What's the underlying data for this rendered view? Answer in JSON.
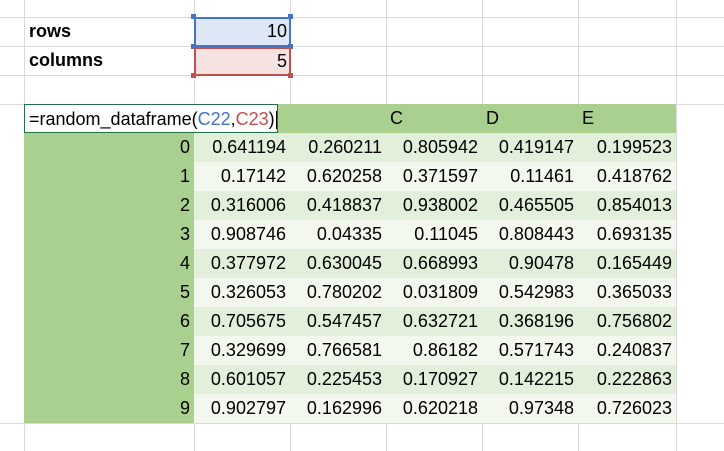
{
  "params": {
    "rows_label": "rows",
    "rows_value": "10",
    "columns_label": "columns",
    "columns_value": "5"
  },
  "formula": {
    "prefix": "=random_dataframe(",
    "ref1": "C22",
    "sep": ",",
    "ref2": "C23",
    "suffix": ")"
  },
  "colors": {
    "ref1": "#4472c4",
    "ref2": "#c0504d",
    "header_fill": "#a9d08e",
    "band_light": "#e2efda",
    "band_lighter": "#f2f8ee"
  },
  "table": {
    "visible_headers": [
      "C",
      "D",
      "E"
    ],
    "index": [
      "0",
      "1",
      "2",
      "3",
      "4",
      "5",
      "6",
      "7",
      "8",
      "9"
    ],
    "rows": [
      [
        "0.641194",
        "0.260211",
        "0.805942",
        "0.419147",
        "0.199523"
      ],
      [
        "0.17142",
        "0.620258",
        "0.371597",
        "0.11461",
        "0.418762"
      ],
      [
        "0.316006",
        "0.418837",
        "0.938002",
        "0.465505",
        "0.854013"
      ],
      [
        "0.908746",
        "0.04335",
        "0.11045",
        "0.808443",
        "0.693135"
      ],
      [
        "0.377972",
        "0.630045",
        "0.668993",
        "0.90478",
        "0.165449"
      ],
      [
        "0.326053",
        "0.780202",
        "0.031809",
        "0.542983",
        "0.365033"
      ],
      [
        "0.705675",
        "0.547457",
        "0.632721",
        "0.368196",
        "0.756802"
      ],
      [
        "0.329699",
        "0.766581",
        "0.86182",
        "0.571743",
        "0.240837"
      ],
      [
        "0.601057",
        "0.225453",
        "0.170927",
        "0.142215",
        "0.222863"
      ],
      [
        "0.902797",
        "0.162996",
        "0.620218",
        "0.97348",
        "0.726023"
      ]
    ]
  }
}
